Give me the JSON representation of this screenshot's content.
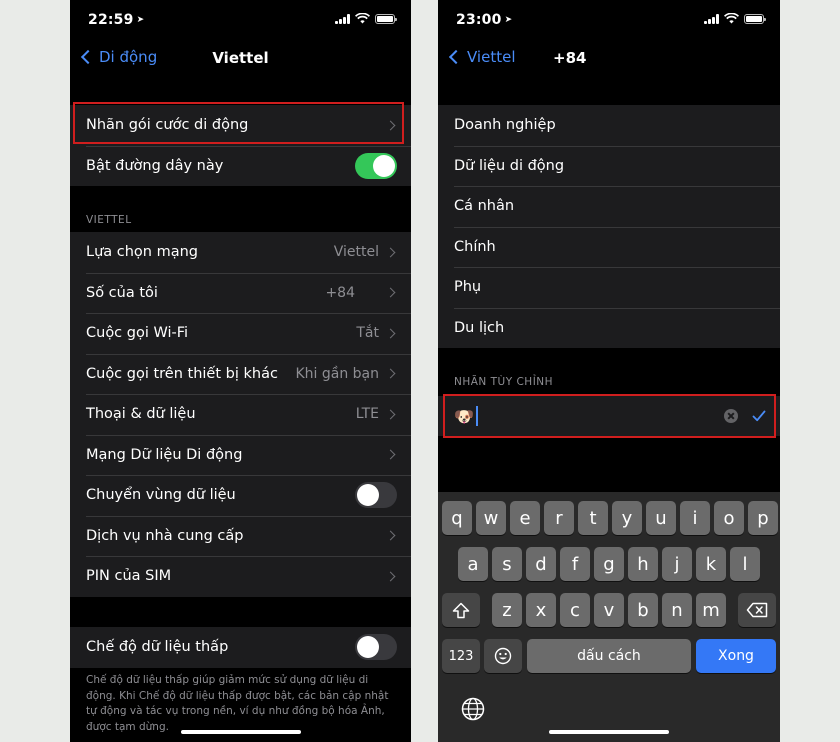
{
  "left_screen": {
    "status": {
      "time": "22:59"
    },
    "nav": {
      "back_label": "Di động",
      "title": "Viettel"
    },
    "group1": [
      {
        "label": "Nhãn gói cước di động"
      },
      {
        "label": "Bật đường dây này",
        "toggle": "on"
      }
    ],
    "section_header": "VIETTEL",
    "group2": [
      {
        "label": "Lựa chọn mạng",
        "value": "Viettel"
      },
      {
        "label": "Số của tôi",
        "value": "+84"
      },
      {
        "label": "Cuộc gọi Wi-Fi",
        "value": "Tắt"
      },
      {
        "label": "Cuộc gọi trên thiết bị khác",
        "value": "Khi gần bạn"
      },
      {
        "label": "Thoại & dữ liệu",
        "value": "LTE"
      },
      {
        "label": "Mạng Dữ liệu Di động",
        "value": ""
      },
      {
        "label": "Chuyển vùng dữ liệu",
        "toggle": "off"
      },
      {
        "label": "Dịch vụ nhà cung cấp",
        "value": ""
      },
      {
        "label": "PIN của SIM",
        "value": ""
      }
    ],
    "group3": [
      {
        "label": "Chế độ dữ liệu thấp",
        "toggle": "off"
      }
    ],
    "footer": "Chế độ dữ liệu thấp giúp giảm mức sử dụng dữ liệu di động. Khi Chế độ dữ liệu thấp được bật, các bản cập nhật tự động và tác vụ trong nền, ví dụ như đồng bộ hóa Ảnh, được tạm dừng."
  },
  "right_screen": {
    "status": {
      "time": "23:00"
    },
    "nav": {
      "back_label": "Viettel",
      "title": "+84"
    },
    "labels": [
      "Doanh nghiệp",
      "Dữ liệu di động",
      "Cá nhân",
      "Chính",
      "Phụ",
      "Du lịch"
    ],
    "custom_header": "NHÃN TÙY CHỈNH",
    "custom_input": {
      "value": "🐶"
    },
    "keyboard": {
      "row1": [
        "q",
        "w",
        "e",
        "r",
        "t",
        "y",
        "u",
        "i",
        "o",
        "p"
      ],
      "row2": [
        "a",
        "s",
        "d",
        "f",
        "g",
        "h",
        "j",
        "k",
        "l"
      ],
      "row3": [
        "z",
        "x",
        "c",
        "v",
        "b",
        "n",
        "m"
      ],
      "numbers_key": "123",
      "space_key": "dấu cách",
      "return_key": "Xong"
    }
  },
  "colors": {
    "accent": "#4a8cf7",
    "toggle_on": "#34c759",
    "highlight": "#d01e1e",
    "cell_bg": "#1c1c1e",
    "return_key": "#3478f6"
  }
}
